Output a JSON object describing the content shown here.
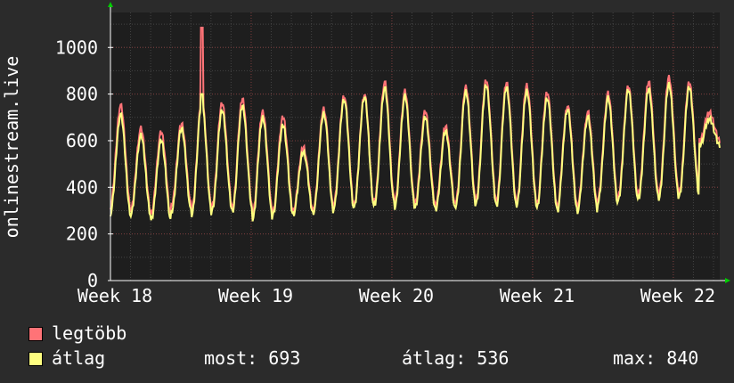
{
  "chart_data": {
    "type": "line",
    "ylabel": "onlinestream.live",
    "y_ticks": [
      0,
      200,
      400,
      600,
      800,
      1000
    ],
    "ylim": [
      0,
      1150
    ],
    "x_ticks": [
      "Week 18",
      "Week 19",
      "Week 20",
      "Week 21",
      "Week 22"
    ],
    "grid": true,
    "colors": {
      "background": "#2b2b2b",
      "plot": "#1e1e1e",
      "grid_major": "#7a3a3a",
      "grid_minor": "#444444",
      "max": "#ff7377",
      "avg": "#ffff80"
    },
    "series": [
      {
        "name": "legtöbb",
        "color": "#ff7377",
        "peaks": [
          750,
          650,
          635,
          670,
          775,
          760,
          780,
          725,
          705,
          575,
          740,
          795,
          800,
          850,
          810,
          725,
          660,
          830,
          860,
          850,
          840,
          810,
          750,
          720,
          800,
          830,
          850,
          870,
          850,
          720
        ],
        "troughs": [
          320,
          300,
          280,
          320,
          300,
          320,
          310,
          290,
          300,
          300,
          310,
          330,
          320,
          340,
          330,
          330,
          320,
          340,
          350,
          340,
          340,
          330,
          320,
          320,
          350,
          360,
          370,
          370,
          380,
          600
        ],
        "spike": 1085
      },
      {
        "name": "átlag",
        "color": "#ffff80",
        "peaks": [
          710,
          620,
          600,
          650,
          760,
          730,
          750,
          700,
          670,
          555,
          720,
          780,
          790,
          825,
          790,
          700,
          640,
          810,
          840,
          830,
          815,
          785,
          735,
          700,
          780,
          815,
          820,
          840,
          830,
          693
        ],
        "troughs": [
          290,
          280,
          255,
          290,
          280,
          300,
          295,
          265,
          285,
          285,
          295,
          310,
          310,
          320,
          310,
          310,
          300,
          320,
          330,
          320,
          325,
          315,
          300,
          300,
          330,
          340,
          350,
          350,
          360,
          580
        ],
        "spike": 800
      }
    ]
  },
  "legend": {
    "max_label": "legtöbb",
    "avg_label": "átlag",
    "stats": {
      "most": "most: 693",
      "atlag": "átlag: 536",
      "max": "max: 840"
    }
  }
}
